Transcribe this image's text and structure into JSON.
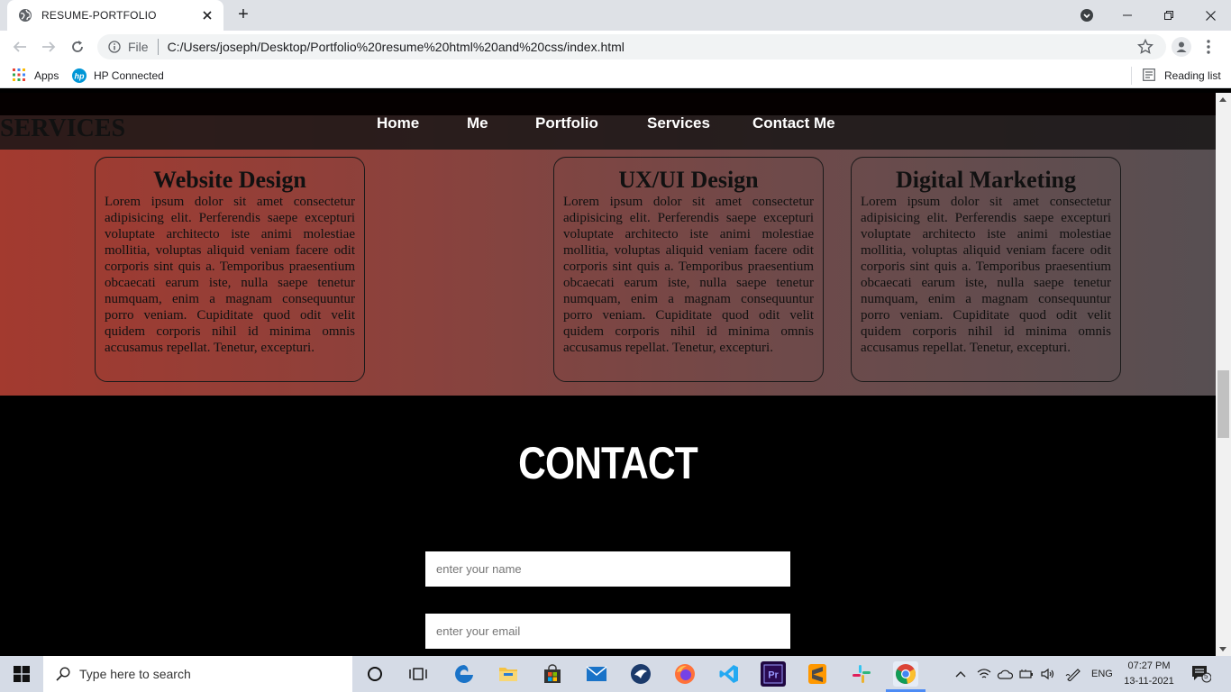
{
  "browser": {
    "tab_title": "RESUME-PORTFOLIO",
    "new_tab": "+",
    "omnibox_scheme": "File",
    "url": "C:/Users/joseph/Desktop/Portfolio%20resume%20html%20and%20css/index.html",
    "bookmarks": {
      "apps_label": "Apps",
      "hp_label": "HP Connected",
      "reading_list_label": "Reading list"
    }
  },
  "page": {
    "nav": {
      "items": [
        {
          "label": "Home"
        },
        {
          "label": "Me"
        },
        {
          "label": "Portfolio"
        },
        {
          "label": "Services"
        },
        {
          "label": "Contact Me"
        }
      ]
    },
    "services": {
      "heading": "SERVICES",
      "cards": [
        {
          "title": "Website Design",
          "body": "Lorem ipsum dolor sit amet consectetur adipisicing elit. Perferendis saepe excepturi voluptate architecto iste animi molestiae mollitia, voluptas aliquid veniam facere odit corporis sint quis a. Temporibus praesentium obcaecati earum iste, nulla saepe tenetur numquam, enim a magnam consequuntur porro veniam. Cupiditate quod odit velit quidem corporis nihil id minima omnis accusamus repellat. Tenetur, excepturi."
        },
        {
          "title": "UX/UI Design",
          "body": "Lorem ipsum dolor sit amet consectetur adipisicing elit. Perferendis saepe excepturi voluptate architecto iste animi molestiae mollitia, voluptas aliquid veniam facere odit corporis sint quis a. Temporibus praesentium obcaecati earum iste, nulla saepe tenetur numquam, enim a magnam consequuntur porro veniam. Cupiditate quod odit velit quidem corporis nihil id minima omnis accusamus repellat. Tenetur, excepturi."
        },
        {
          "title": "Digital Marketing",
          "body": "Lorem ipsum dolor sit amet consectetur adipisicing elit. Perferendis saepe excepturi voluptate architecto iste animi molestiae mollitia, voluptas aliquid veniam facere odit corporis sint quis a. Temporibus praesentium obcaecati earum iste, nulla saepe tenetur numquam, enim a magnam consequuntur porro veniam. Cupiditate quod odit velit quidem corporis nihil id minima omnis accusamus repellat. Tenetur, excepturi."
        }
      ]
    },
    "contact": {
      "heading": "CONTACT",
      "name_placeholder": "enter your name",
      "email_placeholder": "enter your email"
    }
  },
  "taskbar": {
    "search_placeholder": "Type here to search",
    "language": "ENG",
    "time": "07:27 PM",
    "date": "13-11-2021",
    "notification_count": "5"
  },
  "colors": {
    "services_gradient_start": "#a33a2f",
    "services_gradient_end": "#574f52",
    "page_background": "#000000",
    "taskbar": "#d5dbe6",
    "chrome_tab_strip": "#dee1e6"
  },
  "icons": [
    "globe-icon",
    "close-icon",
    "plus-icon",
    "tab-search-icon",
    "minimize-icon",
    "restore-icon",
    "window-close-icon",
    "back-icon",
    "forward-icon",
    "reload-icon",
    "info-icon",
    "star-icon",
    "profile-icon",
    "menu-icon",
    "apps-grid-icon",
    "hp-logo-icon",
    "reading-list-icon",
    "windows-start-icon",
    "search-icon",
    "cortana-icon",
    "task-view-icon",
    "edge-icon",
    "file-explorer-icon",
    "store-icon",
    "mail-icon",
    "cyberghost-icon",
    "firefox-icon",
    "vscode-icon",
    "premiere-icon",
    "sublime-icon",
    "slack-icon",
    "chrome-icon",
    "chevron-up-icon",
    "wifi-icon",
    "onedrive-icon",
    "battery-icon",
    "volume-icon",
    "pen-icon",
    "notification-icon"
  ]
}
